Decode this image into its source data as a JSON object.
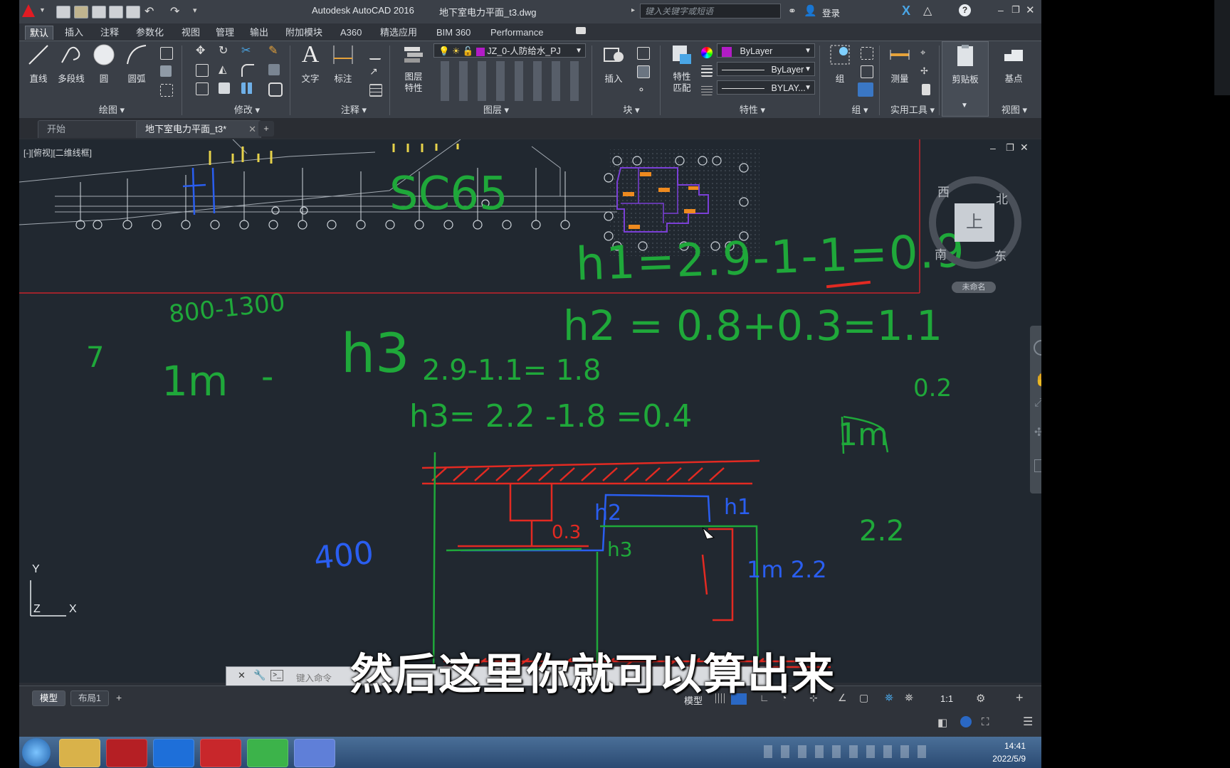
{
  "title_bar": {
    "app_title": "Autodesk AutoCAD 2016",
    "file_name": "地下室电力平面_t3.dwg",
    "search_placeholder": "键入关键字或短语",
    "login_label": "登录"
  },
  "menu_tabs": [
    "默认",
    "插入",
    "注释",
    "参数化",
    "视图",
    "管理",
    "输出",
    "附加模块",
    "A360",
    "精选应用",
    "BIM 360",
    "Performance"
  ],
  "ribbon": {
    "draw_tools": [
      "直线",
      "多段线",
      "圆",
      "圆弧"
    ],
    "text_tool": "文字",
    "dim_tool": "标注",
    "layer_props": "图层\n特性",
    "insert_tool": "插入",
    "match_props": "特性\n匹配",
    "group_tool": "组",
    "measure_tool": "测量",
    "clipboard_tool": "剪贴板",
    "base_tool": "基点",
    "layer_name": "JZ_0-人防给水_PJ",
    "prop_color": "ByLayer",
    "prop_linetype": "ByLayer",
    "prop_lineweight": "BYLAY...",
    "panels": [
      "绘图 ▾",
      "修改 ▾",
      "注释 ▾",
      "图层 ▾",
      "块 ▾",
      "特性 ▾",
      "组 ▾",
      "实用工具 ▾",
      "视图 ▾"
    ]
  },
  "doc_tabs": [
    "开始",
    "地下室电力平面_t3*"
  ],
  "viewport": {
    "label": "[-][俯视][二维线框]",
    "viewcube": {
      "top": "上",
      "north": "北",
      "south": "南",
      "east": "东",
      "west": "西",
      "wcs": "未命名"
    },
    "ucs": {
      "x": "X",
      "y": "Y",
      "z": "Z"
    }
  },
  "handwriting": {
    "h1": "h1=2.9-1-1=0.9",
    "h2": "h2 = 0.8+0.3=1.1",
    "h3_calc": "2.9-1.1= 1.8",
    "h3": "h3= 2.2 -1.8 =0.4",
    "ratio": "800-1300",
    "seven": "7",
    "one_m": "1m",
    "dash": "-",
    "h3_label": "h3",
    "sc": "SC65",
    "point2": "0.2",
    "one_m_right": "1m",
    "two_two": "2.2",
    "four_hundred": "400",
    "sect_h2": "h2",
    "sect_h1": "h1",
    "sect_h3": "h3",
    "sect_03": "0.3",
    "sect_1m22": "1m 2.2"
  },
  "command_placeholder": "键入命令",
  "status": {
    "layout_tabs": [
      "模型",
      "布局1"
    ],
    "model_label": "模型",
    "scale": "1:1"
  },
  "clock": {
    "time": "14:41",
    "date": "2022/5/9"
  },
  "subtitle": "然后这里你就可以算出来",
  "colors": {
    "green_ink": "#1fa83a",
    "red_ink": "#e22a22",
    "blue_ink": "#2a5ef0"
  }
}
